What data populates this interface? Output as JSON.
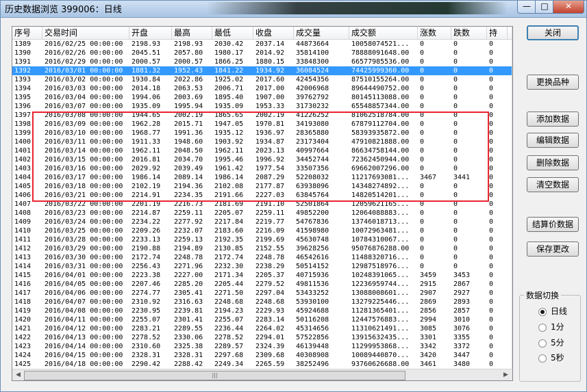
{
  "window": {
    "title": "历史数据浏览 399006：日线"
  },
  "caption_buttons": {
    "minimize": "—",
    "maximize": "□",
    "close": "✕"
  },
  "columns": [
    "序号",
    "交易时间",
    "开盘",
    "最高",
    "最低",
    "收盘",
    "成交量",
    "成交额",
    "涨数",
    "跌数",
    "持"
  ],
  "rows": [
    [
      "1389",
      "2016/02/25 00:00:00",
      "2198.93",
      "2198.93",
      "2030.42",
      "2037.14",
      "44873664",
      "10058074521...",
      "0",
      "0",
      "0"
    ],
    [
      "1390",
      "2016/02/26 00:00:00",
      "2045.51",
      "2057.80",
      "1980.17",
      "2014.92",
      "35814100",
      "78888091648.00",
      "0",
      "0",
      "0"
    ],
    [
      "1391",
      "2016/02/29 00:00:00",
      "2000.57",
      "2000.57",
      "1866.25",
      "1880.15",
      "33848300",
      "66577985536.00",
      "0",
      "0",
      "0"
    ],
    [
      "1392",
      "2016/03/01 00:00:00",
      "1881.32",
      "1952.43",
      "1841.22",
      "1934.92",
      "36084524",
      "74425999360.00",
      "0",
      "0",
      "0"
    ],
    [
      "1393",
      "2016/03/02 00:00:00",
      "1930.84",
      "2022.86",
      "1925.02",
      "2017.60",
      "42454356",
      "87510155264.00",
      "0",
      "0",
      "0"
    ],
    [
      "1394",
      "2016/03/03 00:00:00",
      "2014.18",
      "2063.53",
      "2006.71",
      "2017.00",
      "42006968",
      "89644490752.00",
      "0",
      "0",
      "0"
    ],
    [
      "1395",
      "2016/03/04 00:00:00",
      "1994.06",
      "2003.69",
      "1895.40",
      "1907.00",
      "39762792",
      "80145113088.00",
      "0",
      "0",
      "0"
    ],
    [
      "1396",
      "2016/03/07 00:00:00",
      "1935.09",
      "1995.94",
      "1935.09",
      "1953.33",
      "31730232",
      "65548857344.00",
      "0",
      "0",
      "0"
    ],
    [
      "1397",
      "2016/03/08 00:00:00",
      "1944.65",
      "2002.19",
      "1865.65",
      "2002.19",
      "41226252",
      "81062518784.00",
      "0",
      "0",
      "0"
    ],
    [
      "1398",
      "2016/03/09 00:00:00",
      "1962.28",
      "2015.71",
      "1947.05",
      "1970.81",
      "34193080",
      "67879112704.00",
      "0",
      "0",
      "0"
    ],
    [
      "1399",
      "2016/03/10 00:00:00",
      "1968.77",
      "1991.36",
      "1935.12",
      "1936.97",
      "28365880",
      "58393935872.00",
      "0",
      "0",
      "0"
    ],
    [
      "1400",
      "2016/03/11 00:00:00",
      "1911.33",
      "1948.60",
      "1903.92",
      "1934.87",
      "23173404",
      "47910821888.00",
      "0",
      "0",
      "0"
    ],
    [
      "1401",
      "2016/03/14 00:00:00",
      "1962.11",
      "2048.50",
      "1962.11",
      "2023.13",
      "40997664",
      "86634758144.00",
      "0",
      "0",
      "0"
    ],
    [
      "1402",
      "2016/03/15 00:00:00",
      "2016.81",
      "2034.70",
      "1995.46",
      "1996.92",
      "34452744",
      "72362450944.00",
      "0",
      "0",
      "0"
    ],
    [
      "1403",
      "2016/03/16 00:00:00",
      "2029.92",
      "2039.49",
      "1961.42",
      "1977.54",
      "33507356",
      "69662007296.00",
      "0",
      "0",
      "0"
    ],
    [
      "1404",
      "2016/03/17 00:00:00",
      "1986.14",
      "2089.14",
      "1986.14",
      "2087.29",
      "52208032",
      "11217693081...",
      "3467",
      "3441",
      "0"
    ],
    [
      "1405",
      "2016/03/18 00:00:00",
      "2102.19",
      "2194.36",
      "2102.08",
      "2177.87",
      "63938096",
      "14348274892...",
      "0",
      "0",
      "0"
    ],
    [
      "1406",
      "2016/03/21 00:00:00",
      "2214.91",
      "2234.35",
      "2191.66",
      "2227.03",
      "63845764",
      "14820514201...",
      "0",
      "0",
      "0"
    ],
    [
      "1407",
      "2016/03/22 00:00:00",
      "2201.19",
      "2216.73",
      "2181.69",
      "2191.10",
      "52501864",
      "12059621165...",
      "0",
      "0",
      "0"
    ],
    [
      "1408",
      "2016/03/23 00:00:00",
      "2214.87",
      "2259.11",
      "2205.07",
      "2259.11",
      "49852200",
      "12064088883...",
      "0",
      "0",
      "0"
    ],
    [
      "1409",
      "2016/03/24 00:00:00",
      "2234.22",
      "2277.92",
      "2217.84",
      "2219.77",
      "54767836",
      "13746018713...",
      "0",
      "0",
      "0"
    ],
    [
      "1410",
      "2016/03/25 00:00:00",
      "2209.26",
      "2232.07",
      "2183.60",
      "2216.09",
      "41598980",
      "10072963481...",
      "0",
      "0",
      "0"
    ],
    [
      "1411",
      "2016/03/28 00:00:00",
      "2233.13",
      "2259.13",
      "2192.35",
      "2199.69",
      "45630748",
      "10784310067...",
      "0",
      "0",
      "0"
    ],
    [
      "1412",
      "2016/03/29 00:00:00",
      "2190.88",
      "2194.89",
      "2130.85",
      "2152.55",
      "39628256",
      "95076876288.00",
      "0",
      "0",
      "0"
    ],
    [
      "1413",
      "2016/03/30 00:00:00",
      "2172.74",
      "2248.78",
      "2172.74",
      "2248.78",
      "46542616",
      "11488320716...",
      "0",
      "0",
      "0"
    ],
    [
      "1414",
      "2016/03/31 00:00:00",
      "2256.43",
      "2271.96",
      "2232.30",
      "2238.29",
      "50514152",
      "12987518976...",
      "0",
      "0",
      "0"
    ],
    [
      "1415",
      "2016/04/01 00:00:00",
      "2223.38",
      "2227.00",
      "2171.34",
      "2205.37",
      "40715936",
      "10248391065...",
      "3459",
      "3453",
      "0"
    ],
    [
      "1416",
      "2016/04/05 00:00:00",
      "2207.46",
      "2285.20",
      "2205.44",
      "2279.52",
      "49811536",
      "12236959744...",
      "2915",
      "2867",
      "0"
    ],
    [
      "1417",
      "2016/04/06 00:00:00",
      "2274.77",
      "2305.41",
      "2271.50",
      "2297.04",
      "53433252",
      "13088008601...",
      "2907",
      "2927",
      "0"
    ],
    [
      "1418",
      "2016/04/07 00:00:00",
      "2310.92",
      "2316.63",
      "2248.68",
      "2248.68",
      "53930100",
      "13279225446...",
      "2869",
      "2893",
      "0"
    ],
    [
      "1419",
      "2016/04/08 00:00:00",
      "2230.95",
      "2239.81",
      "2194.23",
      "2229.93",
      "45924688",
      "11281365401...",
      "2856",
      "2857",
      "0"
    ],
    [
      "1420",
      "2016/04/11 00:00:00",
      "2255.07",
      "2301.41",
      "2255.07",
      "2283.14",
      "50116208",
      "12447576883...",
      "2994",
      "3010",
      "0"
    ],
    [
      "1421",
      "2016/04/12 00:00:00",
      "2283.21",
      "2289.55",
      "2236.44",
      "2264.02",
      "45314656",
      "11310621491...",
      "3085",
      "3076",
      "0"
    ],
    [
      "1422",
      "2016/04/13 00:00:00",
      "2278.52",
      "2330.06",
      "2278.52",
      "2294.01",
      "57522856",
      "13915632435...",
      "3301",
      "3355",
      "0"
    ],
    [
      "1423",
      "2016/04/14 00:00:00",
      "2310.60",
      "2325.38",
      "2289.57",
      "2324.39",
      "46139448",
      "11299953868...",
      "3342",
      "3372",
      "0"
    ],
    [
      "1424",
      "2016/04/15 00:00:00",
      "2328.31",
      "2328.31",
      "2297.68",
      "2309.68",
      "40308908",
      "10089440870...",
      "3420",
      "3447",
      "0"
    ],
    [
      "1425",
      "2016/04/18 00:00:00",
      "2290.42",
      "2288.42",
      "2249.34",
      "2265.59",
      "38252496",
      "93760626688.00",
      "3461",
      "3480",
      "0"
    ]
  ],
  "selected_row": "1392",
  "highlight": {
    "color": "#e8242f",
    "first_row": "1397",
    "last_row": "1406"
  },
  "buttons": {
    "close": "关闭",
    "change_variety": "更换品种",
    "add_data": "添加数据",
    "edit_data": "编辑数据",
    "delete_data": "删除数据",
    "clear_data": "清空数据",
    "settlement_data": "结算价数据",
    "save_changes": "保存更改"
  },
  "data_switch": {
    "label": "数据切换",
    "options": [
      "日线",
      "1分",
      "5分",
      "5秒"
    ],
    "selected": "日线"
  },
  "colors": {
    "selection": "#3399ff",
    "title_bar": "#a9c4e4",
    "close_button": "#c4412d"
  }
}
